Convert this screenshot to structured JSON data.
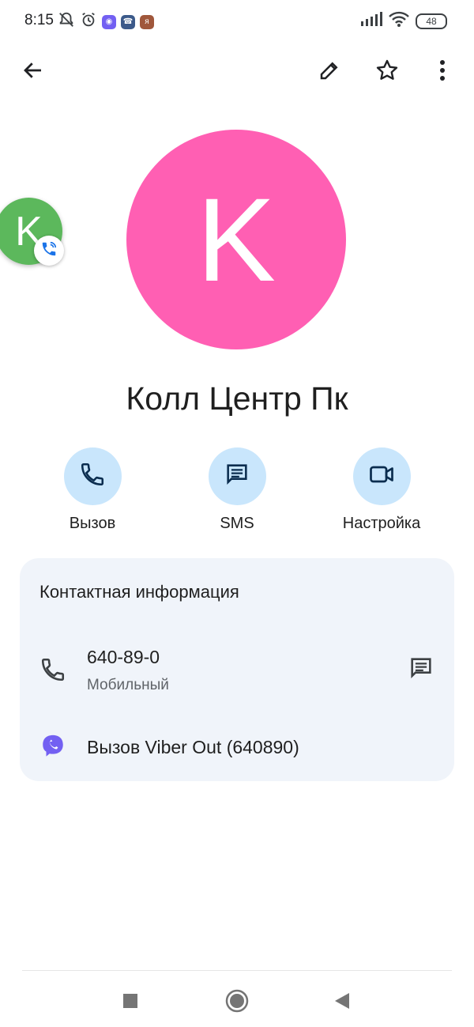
{
  "status_bar": {
    "time": "8:15",
    "battery": "48",
    "icons": [
      "muted-notification-icon",
      "alarm-icon",
      "viber-app-icon",
      "phone-app-icon",
      "app-icon",
      "signal-icon",
      "wifi-icon",
      "battery-icon"
    ]
  },
  "top_bar": {
    "icons": [
      "back-arrow-icon",
      "edit-pencil-icon",
      "star-outline-icon",
      "more-vert-icon"
    ]
  },
  "contact": {
    "initial": "K",
    "name": "Колл Центр Пк",
    "avatar_color": "#ff5fb3"
  },
  "floating_bubble": {
    "initial": "K",
    "color": "#5cb85c"
  },
  "actions": [
    {
      "label": "Вызов",
      "icon": "phone-icon"
    },
    {
      "label": "SMS",
      "icon": "message-icon"
    },
    {
      "label": "Настройка",
      "icon": "videocam-icon"
    }
  ],
  "info_card": {
    "title": "Контактная информация",
    "phone": {
      "number": "640-89-0",
      "type": "Мобильный"
    },
    "viber": {
      "label": "Вызов Viber Out (640890)"
    }
  },
  "colors": {
    "accent_light": "#c9e6fc",
    "card_bg": "#f0f4fa",
    "viber_purple": "#7360f2"
  }
}
